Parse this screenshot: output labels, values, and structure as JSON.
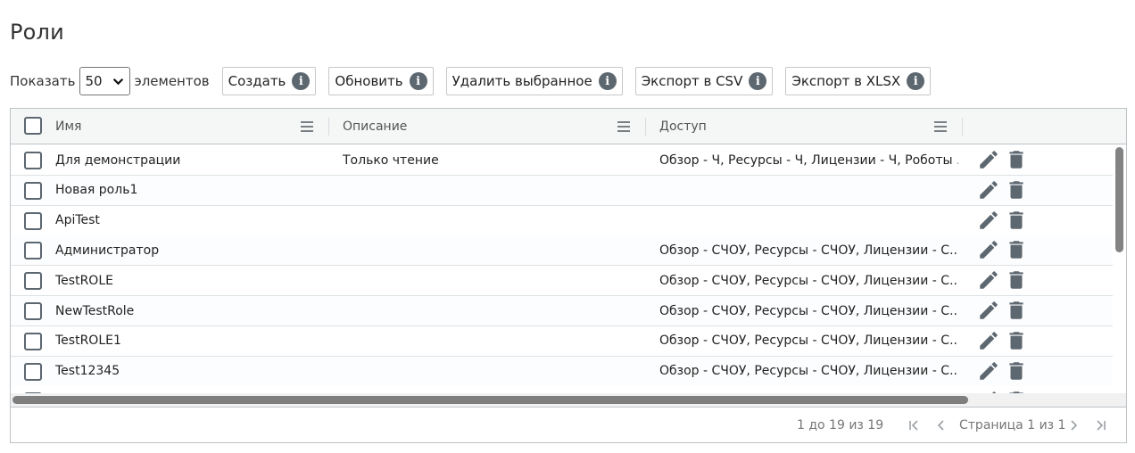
{
  "page": {
    "title": "Роли"
  },
  "toolbar": {
    "show_label": "Показать",
    "page_size": "50",
    "items_label": "элементов",
    "buttons": [
      {
        "label": "Создать",
        "icon": "info-icon"
      },
      {
        "label": "Обновить",
        "icon": "info-icon"
      },
      {
        "label": "Удалить выбранное",
        "icon": "info-icon"
      },
      {
        "label": "Экспорт в CSV",
        "icon": "info-icon"
      },
      {
        "label": "Экспорт в XLSX",
        "icon": "info-icon"
      }
    ],
    "info_glyph": "i"
  },
  "grid": {
    "columns": [
      "Имя",
      "Описание",
      "Доступ"
    ],
    "rows": [
      {
        "name": "Для демонстрации",
        "description": "Только чтение",
        "access": "Обзор - Ч, Ресурсы - Ч, Лицензии - Ч, Роботы ..."
      },
      {
        "name": "Новая роль1",
        "description": "",
        "access": ""
      },
      {
        "name": "ApiTest",
        "description": "",
        "access": ""
      },
      {
        "name": "Администратор",
        "description": "",
        "access": "Обзор - СЧОУ, Ресурсы - СЧОУ, Лицензии - С..."
      },
      {
        "name": "TestROLE",
        "description": "",
        "access": "Обзор - СЧОУ, Ресурсы - СЧОУ, Лицензии - С..."
      },
      {
        "name": "NewTestRole",
        "description": "",
        "access": "Обзор - СЧОУ, Ресурсы - СЧОУ, Лицензии - С..."
      },
      {
        "name": "TestROLE1",
        "description": "",
        "access": "Обзор - СЧОУ, Ресурсы - СЧОУ, Лицензии - С..."
      },
      {
        "name": "Test12345",
        "description": "",
        "access": "Обзор - СЧОУ, Ресурсы - СЧОУ, Лицензии - С..."
      }
    ],
    "row_actions": [
      "pencil-icon",
      "trash-icon"
    ]
  },
  "footer": {
    "range": "1 до 19 из 19",
    "page_info": "Страница 1 из 1"
  },
  "colors": {
    "icon": "#5d6770",
    "border": "#bdc3c7",
    "header_bg": "#f5f7f7"
  }
}
